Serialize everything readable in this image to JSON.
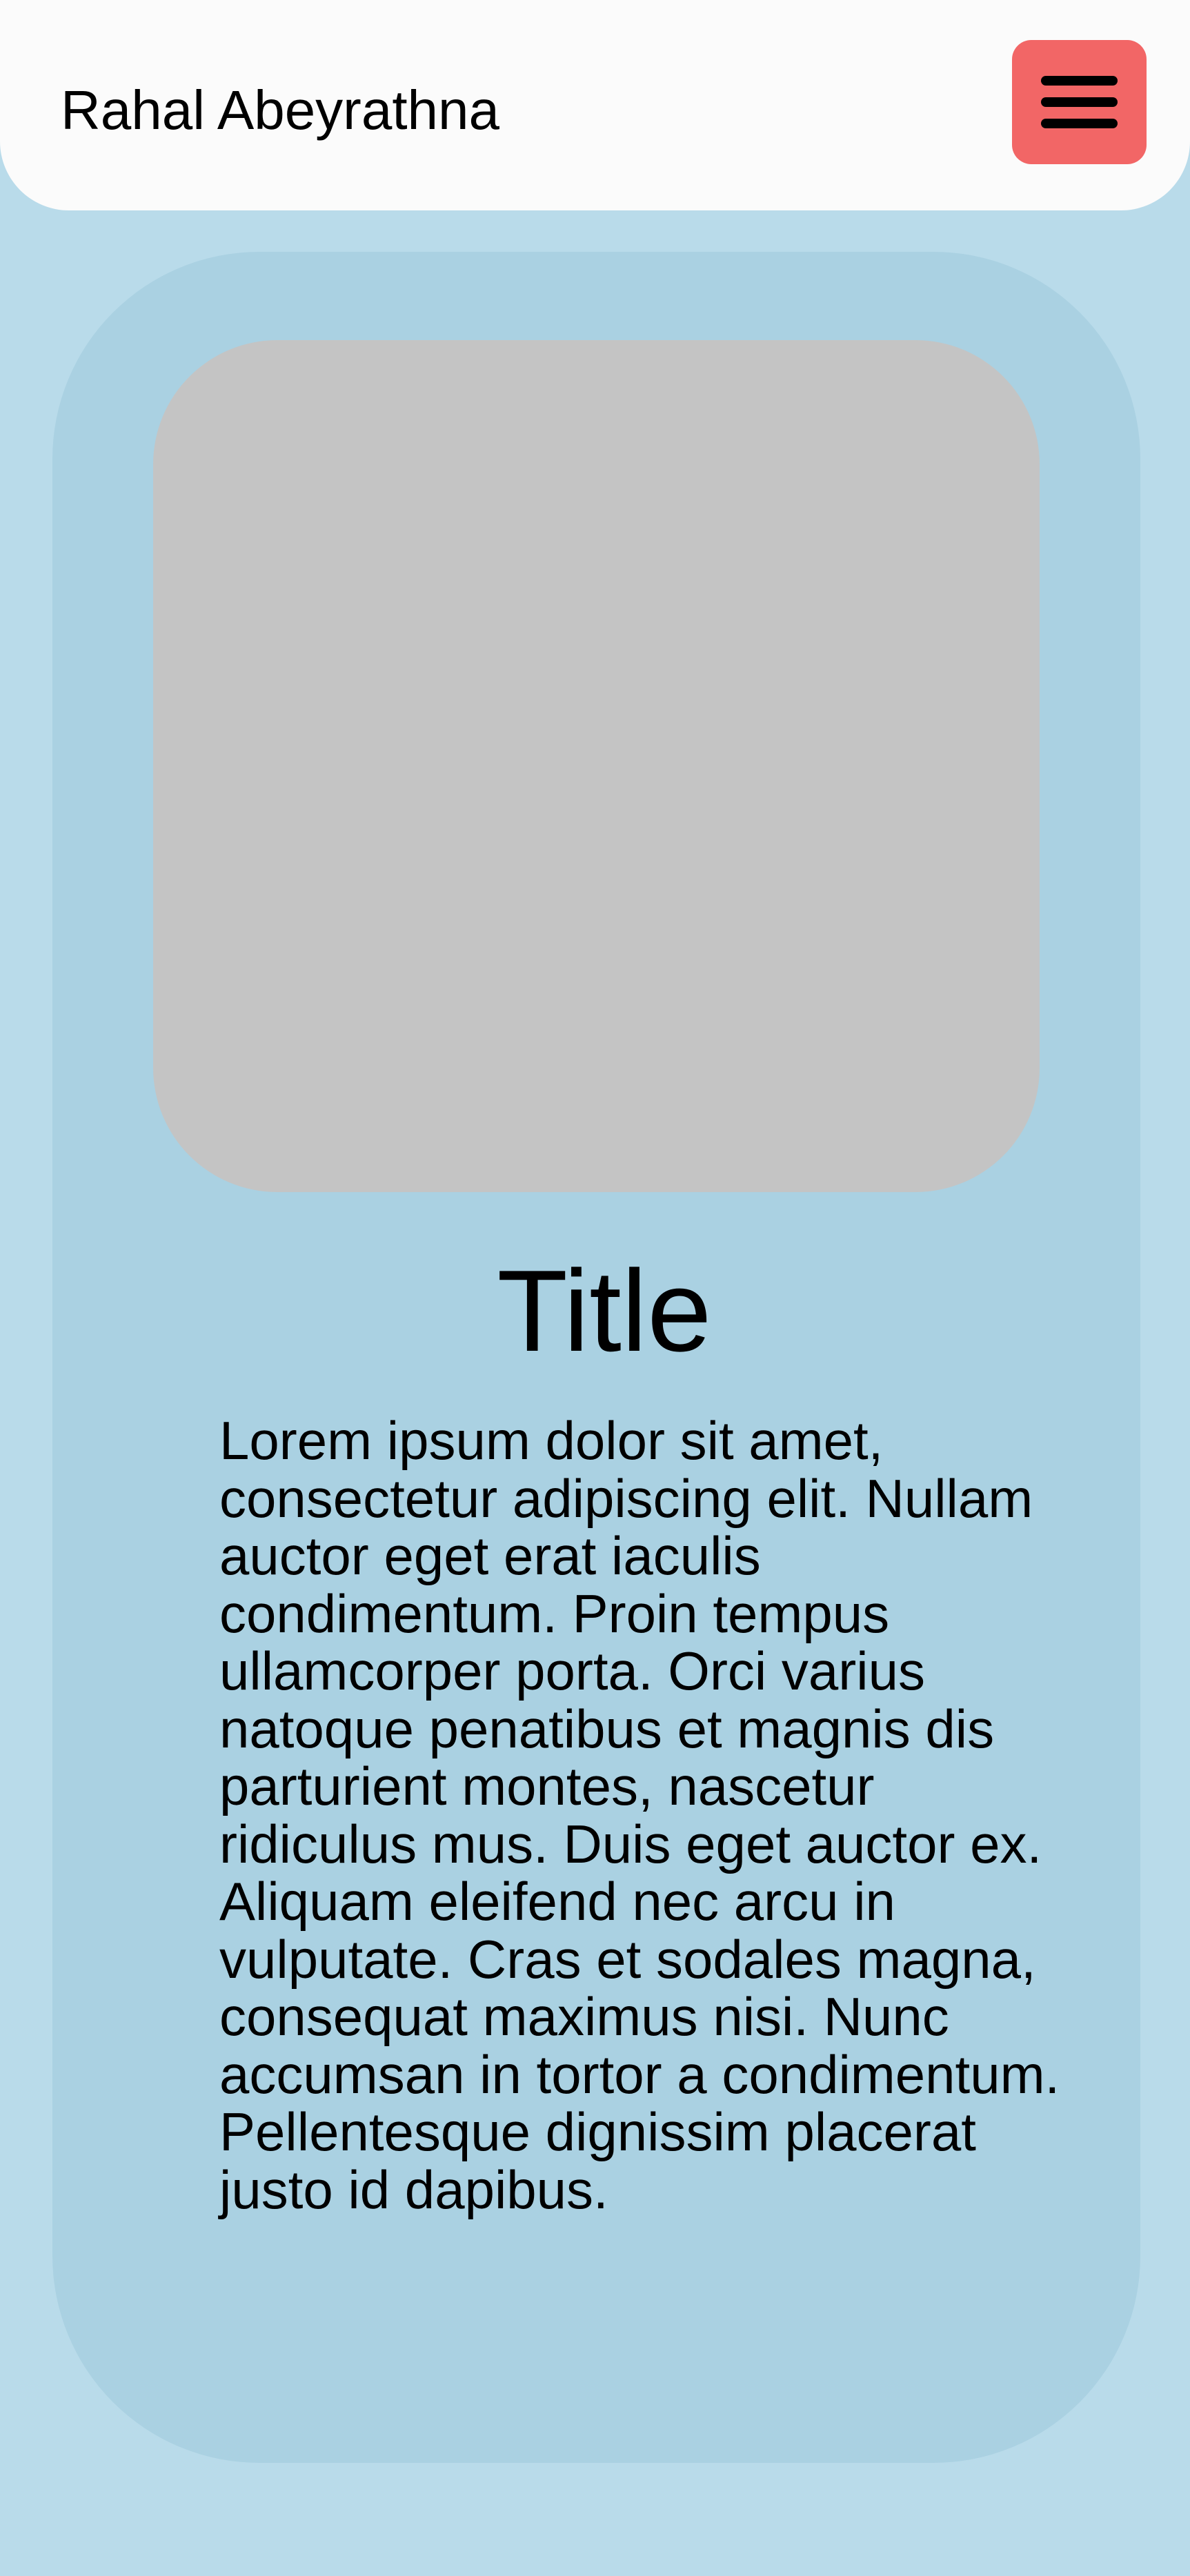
{
  "header": {
    "site_name": "Rahal Abeyrathna",
    "menu_icon": "hamburger-menu-icon"
  },
  "card": {
    "title": "Title",
    "body": "Lorem ipsum dolor sit amet, consectetur adipiscing elit. Nullam auctor eget erat iaculis condimentum. Proin tempus ullamcorper porta. Orci varius natoque penatibus et magnis dis parturient montes, nascetur ridiculus mus. Duis eget auctor ex. Aliquam eleifend nec arcu in vulputate. Cras et sodales magna, consequat maximus nisi. Nunc accumsan in tortor a condimentum. Pellentesque dignissim placerat justo id dapibus."
  },
  "colors": {
    "page_background": "#b9dbea",
    "header_background": "#fbfbfb",
    "menu_button": "#f26666",
    "card_background": "#aad1e2",
    "image_placeholder": "#c4c4c4"
  }
}
